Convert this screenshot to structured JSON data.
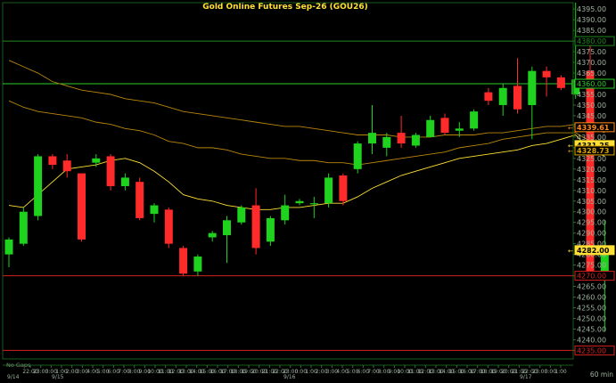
{
  "chart_data": {
    "type": "candlestick",
    "title": "Gold  Online  Futures  Sep-26  (GOU26)",
    "ylim": [
      4231,
      4398
    ],
    "y_ticks": [
      4235,
      4240,
      4245,
      4250,
      4255,
      4260,
      4265,
      4270,
      4275,
      4280,
      4285,
      4290,
      4295,
      4300,
      4305,
      4310,
      4315,
      4320,
      4325,
      4330,
      4335,
      4340,
      4345,
      4350,
      4355,
      4360,
      4365,
      4370,
      4375,
      4380,
      4385,
      4390,
      4395
    ],
    "time_labels": [
      "22:00",
      "23:00",
      "0:00",
      "1:00",
      "2:00",
      "3:00",
      "4:00",
      "5:00",
      "6:00",
      "7:00",
      "8:00",
      "9:00",
      "10:00",
      "11:00",
      "12:00",
      "13:00",
      "14:00",
      "15:00",
      "16:00",
      "17:00",
      "18:00",
      "19:00",
      "20:00",
      "21:00",
      "22:00",
      "23:00",
      "0:00",
      "1:00",
      "2:00",
      "3:00",
      "4:00",
      "5:00",
      "6:00",
      "7:00",
      "8:00",
      "9:00",
      "10:00",
      "11:00",
      "12:00",
      "13:00",
      "14:00",
      "15:00",
      "16:00",
      "17:00",
      "18:00",
      "19:00",
      "20:00",
      "21:00",
      "22:00",
      "23:00",
      "0:00",
      "1:00"
    ],
    "date_labels": [
      "9/14",
      "9/15",
      "9/16",
      "9/17"
    ],
    "interval_label": "60  min",
    "note": "No  Gaps",
    "candles": [
      {
        "o": 4280,
        "h": 4288,
        "l": 4274,
        "c": 4287
      },
      {
        "o": 4285,
        "h": 4302,
        "l": 4284,
        "c": 4300
      },
      {
        "o": 4298,
        "h": 4327,
        "l": 4296,
        "c": 4326
      },
      {
        "o": 4326,
        "h": 4327,
        "l": 4320,
        "c": 4322
      },
      {
        "o": 4324,
        "h": 4327,
        "l": 4316,
        "c": 4319
      },
      {
        "o": 4318,
        "h": 4318,
        "l": 4286,
        "c": 4287
      },
      {
        "o": 4323,
        "h": 4327,
        "l": 4321,
        "c": 4325
      },
      {
        "o": 4326,
        "h": 4327,
        "l": 4310,
        "c": 4312
      },
      {
        "o": 4312,
        "h": 4318,
        "l": 4310,
        "c": 4316
      },
      {
        "o": 4314,
        "h": 4316,
        "l": 4296,
        "c": 4297
      },
      {
        "o": 4299,
        "h": 4304,
        "l": 4295,
        "c": 4303
      },
      {
        "o": 4301,
        "h": 4302,
        "l": 4283,
        "c": 4285
      },
      {
        "o": 4283,
        "h": 4284,
        "l": 4270,
        "c": 4271
      },
      {
        "o": 4272,
        "h": 4280,
        "l": 4270,
        "c": 4279
      },
      {
        "o": 4288,
        "h": 4291,
        "l": 4286,
        "c": 4290
      },
      {
        "o": 4289,
        "h": 4298,
        "l": 4276,
        "c": 4296
      },
      {
        "o": 4295,
        "h": 4303,
        "l": 4294,
        "c": 4302
      },
      {
        "o": 4303,
        "h": 4311,
        "l": 4280,
        "c": 4283
      },
      {
        "o": 4286,
        "h": 4298,
        "l": 4284,
        "c": 4297
      },
      {
        "o": 4296,
        "h": 4308,
        "l": 4294,
        "c": 4303
      },
      {
        "o": 4304,
        "h": 4306,
        "l": 4303,
        "c": 4305
      },
      {
        "o": 4304,
        "h": 4307,
        "l": 4297,
        "c": 4304
      },
      {
        "o": 4304,
        "h": 4318,
        "l": 4302,
        "c": 4316
      },
      {
        "o": 4317,
        "h": 4318,
        "l": 4303,
        "c": 4305
      },
      {
        "o": 4320,
        "h": 4333,
        "l": 4318,
        "c": 4332
      },
      {
        "o": 4332,
        "h": 4350,
        "l": 4327,
        "c": 4337
      },
      {
        "o": 4330,
        "h": 4337,
        "l": 4326,
        "c": 4335
      },
      {
        "o": 4337,
        "h": 4345,
        "l": 4330,
        "c": 4332
      },
      {
        "o": 4331,
        "h": 4337,
        "l": 4330,
        "c": 4336
      },
      {
        "o": 4335,
        "h": 4345,
        "l": 4335,
        "c": 4343
      },
      {
        "o": 4344,
        "h": 4346,
        "l": 4336,
        "c": 4337
      },
      {
        "o": 4338,
        "h": 4342,
        "l": 4335,
        "c": 4339
      },
      {
        "o": 4339,
        "h": 4348,
        "l": 4338,
        "c": 4347
      },
      {
        "o": 4356,
        "h": 4358,
        "l": 4350,
        "c": 4352
      },
      {
        "o": 4350,
        "h": 4360,
        "l": 4345,
        "c": 4358
      },
      {
        "o": 4359,
        "h": 4372,
        "l": 4346,
        "c": 4348
      },
      {
        "o": 4350,
        "h": 4368,
        "l": 4334,
        "c": 4366
      },
      {
        "o": 4366,
        "h": 4368,
        "l": 4354,
        "c": 4363
      },
      {
        "o": 4363,
        "h": 4364,
        "l": 4357,
        "c": 4358
      },
      {
        "o": 4355,
        "h": 4398,
        "l": 4353,
        "c": 4362
      },
      {
        "o": 4366,
        "h": 4379,
        "l": 4270,
        "c": 4272
      },
      {
        "o": 4270,
        "h": 4296,
        "l": 4244,
        "c": 4282
      }
    ],
    "moving_averages": [
      {
        "color": "#b8860b",
        "values": [
          4371,
          4368,
          4365,
          4361,
          4359,
          4357,
          4356,
          4355,
          4353,
          4352,
          4351,
          4349,
          4347,
          4346,
          4345,
          4344,
          4343,
          4342,
          4341,
          4340,
          4340,
          4339,
          4338,
          4337,
          4336,
          4336,
          4336,
          4335,
          4335,
          4335,
          4336,
          4336,
          4336,
          4337,
          4337,
          4338,
          4339,
          4340,
          4340,
          4341,
          4340,
          4337
        ]
      },
      {
        "color": "#b8860b",
        "values": [
          4352,
          4349,
          4347,
          4346,
          4345,
          4344,
          4342,
          4341,
          4339,
          4338,
          4336,
          4333,
          4332,
          4330,
          4330,
          4329,
          4327,
          4326,
          4325,
          4325,
          4324,
          4324,
          4323,
          4323,
          4322,
          4323,
          4324,
          4325,
          4326,
          4327,
          4328,
          4330,
          4331,
          4332,
          4334,
          4335,
          4336,
          4337,
          4337,
          4337,
          4333,
          4329
        ]
      },
      {
        "color": "#ffe033",
        "values": [
          4303,
          4302,
          4308,
          4314,
          4320,
          4321,
          4322,
          4324,
          4325,
          4323,
          4319,
          4314,
          4308,
          4306,
          4305,
          4303,
          4302,
          4301,
          4301,
          4302,
          4302,
          4303,
          4304,
          4304,
          4307,
          4311,
          4314,
          4317,
          4319,
          4321,
          4323,
          4325,
          4326,
          4327,
          4328,
          4329,
          4331,
          4332,
          4334,
          4336,
          4329,
          4326
        ]
      }
    ],
    "horizontal_levels": [
      {
        "value": 4380,
        "color": "#1f8a1f",
        "label": "4380.00"
      },
      {
        "value": 4360,
        "color": "#2bd12b",
        "label": "4360.00"
      },
      {
        "value": 4270,
        "color": "#d22020",
        "label": "4270.00"
      },
      {
        "value": 4235,
        "color": "#d22020",
        "label": "4235.00"
      }
    ],
    "price_tags": [
      {
        "value": 4339.61,
        "label": "4339.61",
        "bg": "#000",
        "fg": "#ff8c1a",
        "border": "#ff8c1a"
      },
      {
        "value": 4331.25,
        "label": "4331.25",
        "bg": "#ffe033",
        "fg": "#000",
        "border": "#ffe033"
      },
      {
        "value": 4328.73,
        "label": "4328.73",
        "bg": "#000",
        "fg": "#d9a400",
        "border": "#d9a400"
      },
      {
        "value": 4282.0,
        "label": "4282.00",
        "bg": "#ffe033",
        "fg": "#000",
        "border": "#ffe033"
      }
    ],
    "colors": {
      "up": "#1ed21e",
      "down": "#ff2a2a",
      "axis": "#1a5c1a",
      "text": "#9fb39f",
      "title": "#ffe033"
    }
  }
}
